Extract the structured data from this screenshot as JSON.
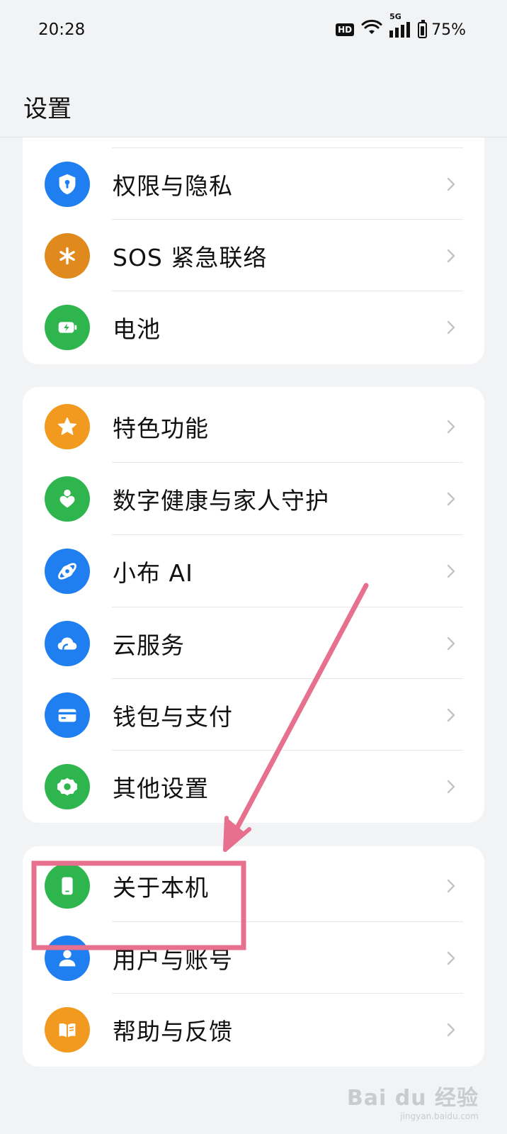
{
  "status_bar": {
    "time": "20:28",
    "hd": "HD",
    "network": "5G",
    "battery": "75%"
  },
  "header": {
    "title": "设置"
  },
  "groups": [
    {
      "items": [
        {
          "label": "权限与隐私",
          "icon": "shield-keyhole-icon",
          "color": "#1f7ef0"
        },
        {
          "label": "SOS 紧急联络",
          "icon": "asterisk-icon",
          "color": "#e08a1e"
        },
        {
          "label": "电池",
          "icon": "battery-charging-icon",
          "color": "#2fb54e"
        }
      ]
    },
    {
      "items": [
        {
          "label": "特色功能",
          "icon": "star-icon",
          "color": "#f29a1f"
        },
        {
          "label": "数字健康与家人守护",
          "icon": "person-heart-icon",
          "color": "#2fb54e"
        },
        {
          "label": "小布 AI",
          "icon": "orbit-icon",
          "color": "#1f7ef0"
        },
        {
          "label": "云服务",
          "icon": "cloud-icon",
          "color": "#1f7ef0"
        },
        {
          "label": "钱包与支付",
          "icon": "card-icon",
          "color": "#1f7ef0"
        },
        {
          "label": "其他设置",
          "icon": "gear-icon",
          "color": "#2fb54e"
        }
      ]
    },
    {
      "items": [
        {
          "label": "关于本机",
          "icon": "phone-icon",
          "color": "#2fb54e"
        },
        {
          "label": "用户与账号",
          "icon": "user-icon",
          "color": "#1f7ef0"
        },
        {
          "label": "帮助与反馈",
          "icon": "book-icon",
          "color": "#f29a1f"
        }
      ]
    }
  ],
  "annotation": {
    "highlight_color": "#e8708f",
    "arrow_color": "#e8708f"
  },
  "watermark": {
    "main": "Bai du 经验",
    "sub": "jingyan.baidu.com"
  }
}
